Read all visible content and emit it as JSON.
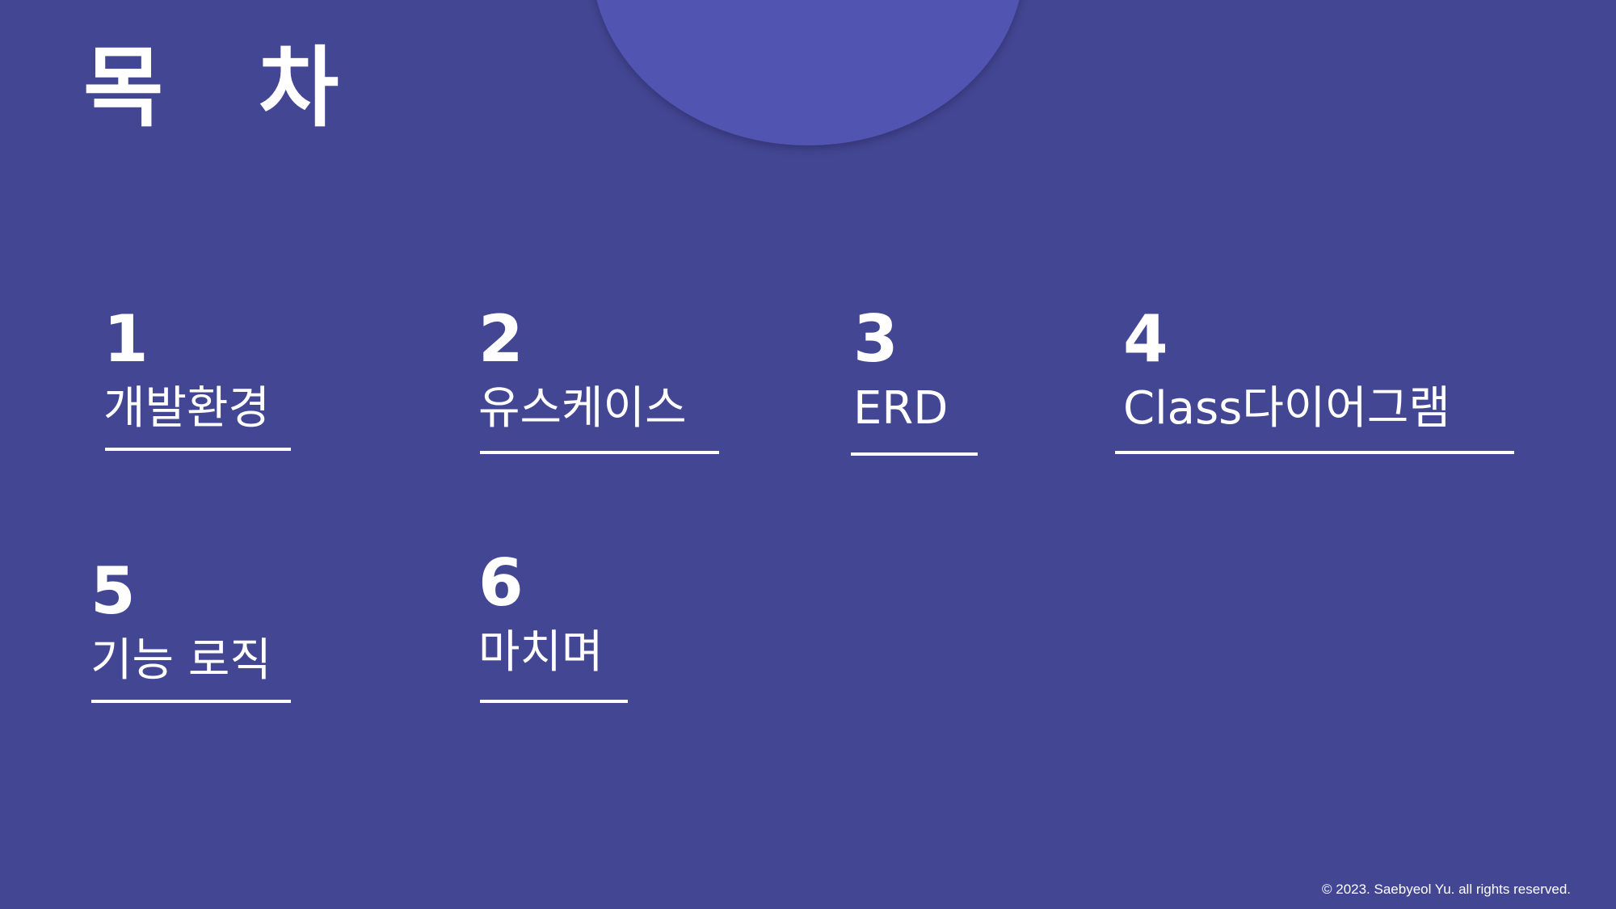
{
  "slide": {
    "title": "목 차",
    "items": [
      {
        "num": "1",
        "label": "개발환경"
      },
      {
        "num": "2",
        "label": "유스케이스"
      },
      {
        "num": "3",
        "label": "ERD"
      },
      {
        "num": "4",
        "label": "Class다이어그램"
      },
      {
        "num": "5",
        "label": "기능 로직"
      },
      {
        "num": "6",
        "label": "마치며"
      }
    ],
    "footer": "© 2023. Saebyeol Yu. all rights reserved."
  },
  "colors": {
    "background": "#434793",
    "circle": "#5154b0",
    "text": "#ffffff"
  }
}
